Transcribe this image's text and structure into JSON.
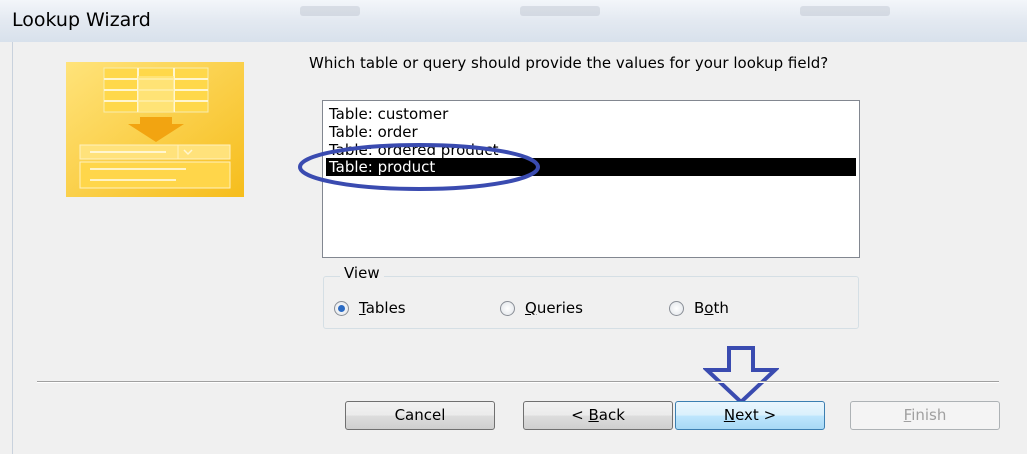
{
  "window": {
    "title": "Lookup Wizard"
  },
  "prompt": "Which table or query should provide the values for your lookup field?",
  "list": {
    "items": [
      "Table: customer",
      "Table: order",
      "Table: ordered product",
      "Table: product"
    ],
    "selected": "Table: product"
  },
  "view": {
    "legend": "View",
    "options": [
      {
        "label": "Tables",
        "access_key": "T",
        "rest": "ables",
        "checked": true
      },
      {
        "label": "Queries",
        "access_key": "Q",
        "rest": "ueries",
        "checked": false
      },
      {
        "label": "Both",
        "access_key": "o",
        "pre": "B",
        "rest": "th",
        "checked": false
      }
    ]
  },
  "buttons": {
    "cancel": "Cancel",
    "back": {
      "pre": "< ",
      "key": "B",
      "rest": "ack"
    },
    "next": {
      "key": "N",
      "rest": "ext >"
    },
    "finish": {
      "key": "F",
      "rest": "inish"
    }
  },
  "annotations": {
    "color": "#3a4bb0"
  }
}
